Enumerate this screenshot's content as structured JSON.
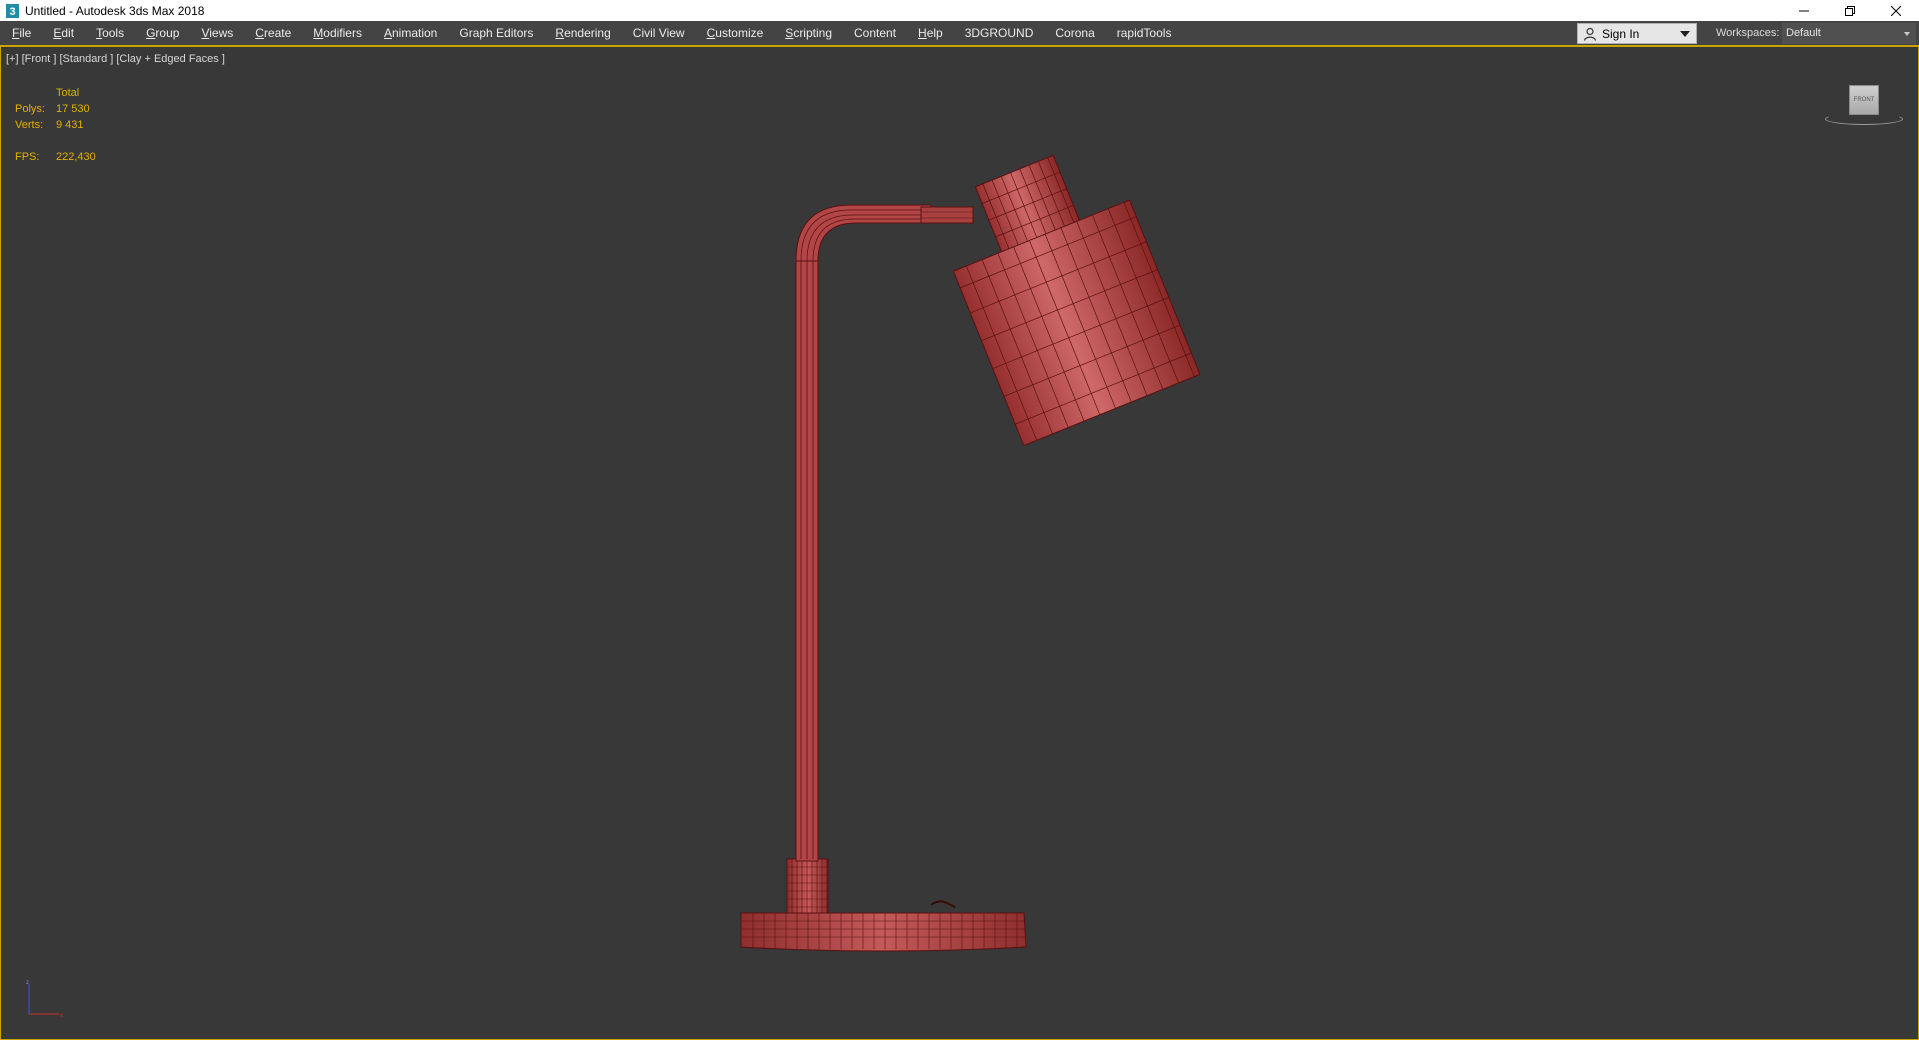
{
  "window": {
    "title": "Untitled - Autodesk 3ds Max 2018"
  },
  "menu": {
    "items": [
      {
        "label": "File",
        "mnemonic": "F",
        "rest": "ile"
      },
      {
        "label": "Edit",
        "mnemonic": "E",
        "rest": "dit"
      },
      {
        "label": "Tools",
        "mnemonic": "T",
        "rest": "ools"
      },
      {
        "label": "Group",
        "mnemonic": "G",
        "rest": "roup"
      },
      {
        "label": "Views",
        "mnemonic": "V",
        "rest": "iews"
      },
      {
        "label": "Create",
        "mnemonic": "C",
        "rest": "reate"
      },
      {
        "label": "Modifiers",
        "mnemonic": "M",
        "rest": "odifiers"
      },
      {
        "label": "Animation",
        "mnemonic": "A",
        "rest": "nimation"
      },
      {
        "label": "Graph Editors",
        "mnemonic": "",
        "rest": "Graph Editors"
      },
      {
        "label": "Rendering",
        "mnemonic": "R",
        "rest": "endering"
      },
      {
        "label": "Civil View",
        "mnemonic": "",
        "rest": "Civil View"
      },
      {
        "label": "Customize",
        "mnemonic": "C",
        "rest": "ustomize"
      },
      {
        "label": "Scripting",
        "mnemonic": "S",
        "rest": "cripting"
      },
      {
        "label": "Content",
        "mnemonic": "",
        "rest": "Content"
      },
      {
        "label": "Help",
        "mnemonic": "H",
        "rest": "elp"
      },
      {
        "label": "3DGROUND",
        "mnemonic": "",
        "rest": "3DGROUND"
      },
      {
        "label": "Corona",
        "mnemonic": "",
        "rest": "Corona"
      },
      {
        "label": "rapidTools",
        "mnemonic": "",
        "rest": "rapidTools"
      }
    ],
    "sign_in": "Sign In",
    "workspaces_label": "Workspaces:",
    "workspaces_value": "Default"
  },
  "viewport": {
    "label": "[+] [Front ] [Standard ] [Clay + Edged Faces ]",
    "stats": {
      "header": "Total",
      "polys_label": "Polys:",
      "polys_value": "17 530",
      "verts_label": "Verts:",
      "verts_value": "9 431",
      "fps_label": "FPS:",
      "fps_value": "222,430"
    },
    "viewcube_face": "FRONT"
  },
  "colors": {
    "menubar": "#444444",
    "viewport_bg": "#383838",
    "active_border": "#c9a400",
    "stats_text": "#e3b100",
    "clay": "#b84848",
    "wire": "#5a1010"
  }
}
